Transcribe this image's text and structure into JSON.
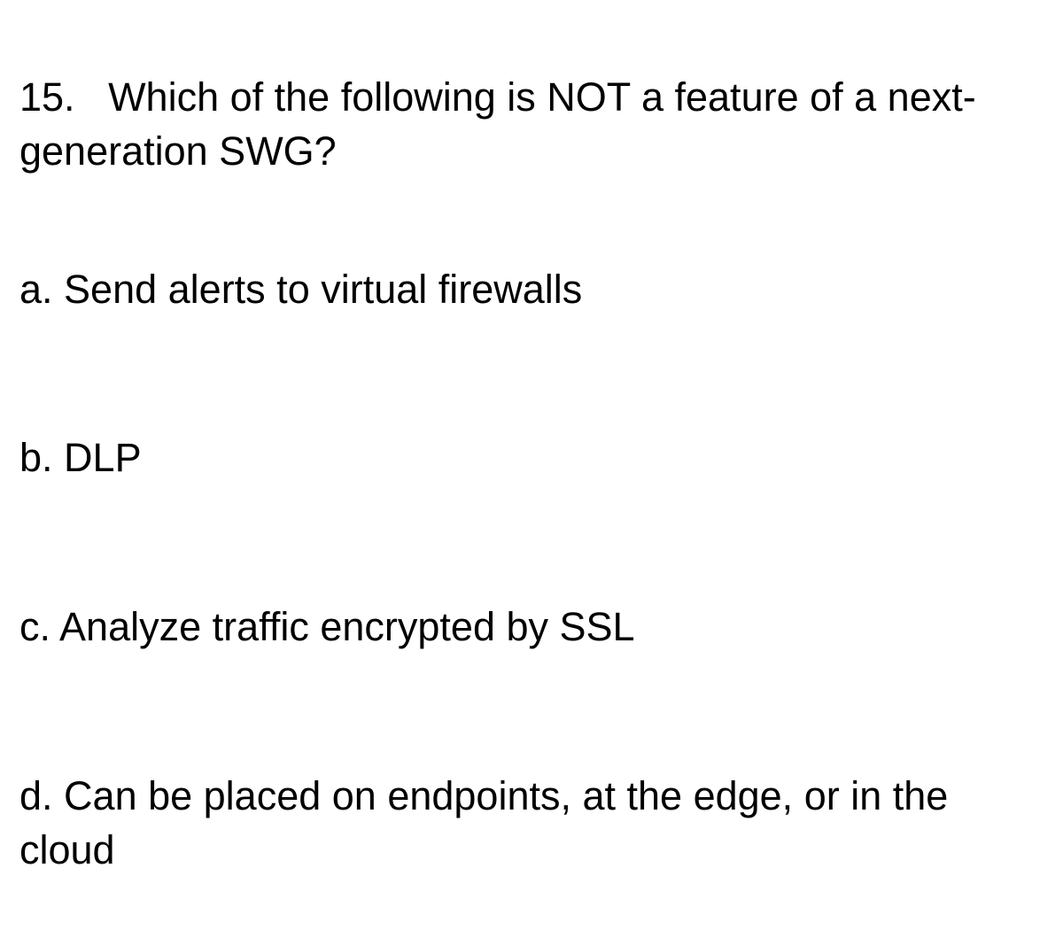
{
  "question": {
    "number": "15.",
    "text": "Which of the following is NOT a feature of a next-generation SWG?"
  },
  "options": [
    {
      "letter": "a.",
      "text": "Send alerts to virtual firewalls"
    },
    {
      "letter": "b.",
      "text": "DLP"
    },
    {
      "letter": "c.",
      "text": "Analyze traffic encrypted by SSL"
    },
    {
      "letter": "d.",
      "text": "Can be placed on endpoints, at the edge, or in the cloud"
    }
  ]
}
